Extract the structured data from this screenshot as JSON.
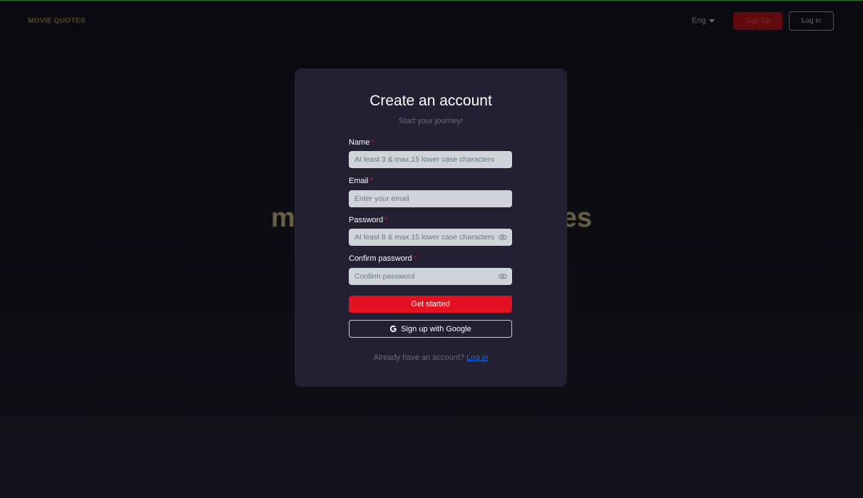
{
  "header": {
    "logo": "MOVIE QUOTES",
    "language": "Eng",
    "signup_label": "Sign Up",
    "login_label": "Log in"
  },
  "hero": {
    "left_fragment": "m",
    "right_fragment": "es"
  },
  "modal": {
    "title": "Create an account",
    "subtitle": "Start your journey!",
    "fields": {
      "name": {
        "label": "Name",
        "required_mark": "*",
        "placeholder": "At least 3 & max.15 lower case characters"
      },
      "email": {
        "label": "Email",
        "required_mark": "*",
        "placeholder": "Enter your email"
      },
      "password": {
        "label": "Password",
        "required_mark": "*",
        "placeholder": "At least 8 & max.15 lower case characters"
      },
      "confirm_password": {
        "label": "Confirm password",
        "required_mark": "*",
        "placeholder": "Confirm password"
      }
    },
    "submit_label": "Get started",
    "google_label": "Sign up with Google",
    "footer_text": "Already have an account?",
    "footer_link": "Log in"
  },
  "colors": {
    "accent": "#e31221",
    "modal_bg": "#222031",
    "input_bg": "#ced4da",
    "link": "#0d6efd"
  },
  "icons": [
    "eye-icon",
    "google-icon",
    "caret-down-icon"
  ]
}
